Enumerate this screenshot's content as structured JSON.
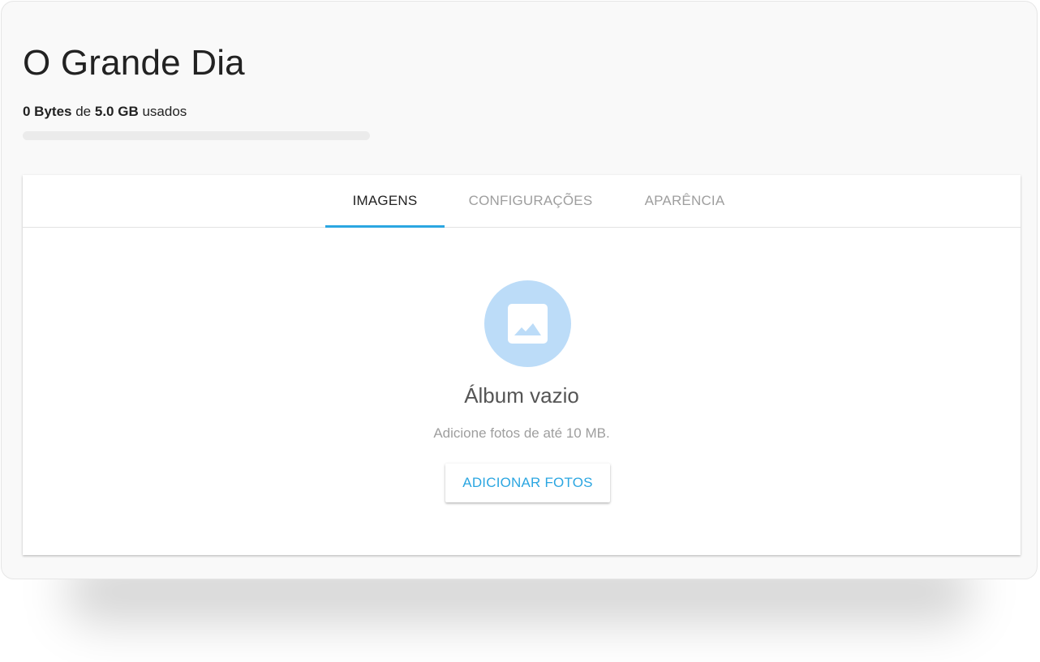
{
  "page": {
    "title": "O Grande Dia"
  },
  "storage": {
    "used": "0 Bytes",
    "connector": "de",
    "total": "5.0 GB",
    "suffix": "usados",
    "used_fraction": 0
  },
  "tabs": [
    {
      "label": "IMAGENS",
      "active": true
    },
    {
      "label": "CONFIGURAÇÕES",
      "active": false
    },
    {
      "label": "APARÊNCIA",
      "active": false
    }
  ],
  "empty_state": {
    "icon": "image-icon",
    "title": "Álbum vazio",
    "subtitle": "Adicione fotos de até 10 MB.",
    "button_label": "ADICIONAR FOTOS"
  },
  "colors": {
    "accent": "#2ba6e1",
    "icon_circle": "#bcdcf8",
    "background": "#f9f9f9"
  }
}
